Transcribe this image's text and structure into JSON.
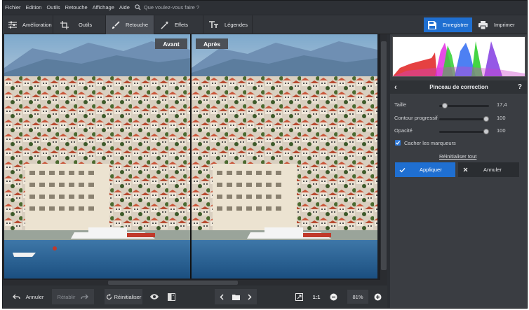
{
  "menu": [
    "Fichier",
    "Edition",
    "Outils",
    "Retouche",
    "Affichage",
    "Aide"
  ],
  "search": {
    "placeholder": "Que voulez-vous faire ?"
  },
  "toolbar": {
    "tabs": [
      {
        "label": "Amélioration",
        "icon": "sliders-icon"
      },
      {
        "label": "Outils",
        "icon": "crop-icon"
      },
      {
        "label": "Retouche",
        "icon": "brush-icon",
        "active": true
      },
      {
        "label": "Effets",
        "icon": "magic-wand-icon"
      },
      {
        "label": "Légendes",
        "icon": "text-icon"
      }
    ],
    "save_label": "Enregistrer",
    "print_label": "Imprimer"
  },
  "view": {
    "before_label": "Avant",
    "after_label": "Après"
  },
  "panel": {
    "title": "Pinceau de correction",
    "help": "?",
    "size": {
      "label": "Taille",
      "value": "17,4",
      "fraction": 0.07
    },
    "feather": {
      "label": "Contour progressif",
      "value": "100",
      "fraction": 1.0
    },
    "opacity": {
      "label": "Opacité",
      "value": "100",
      "fraction": 1.0
    },
    "hide_markers": {
      "label": "Cacher les marqueurs",
      "checked": true
    },
    "reset_all": "Réinitialiser tout",
    "apply_label": "Appliquer",
    "cancel_label": "Annuler"
  },
  "bottom": {
    "undo": "Annuler",
    "redo": "Rétablir",
    "reset": "Réinitialiser",
    "zoom_ratio": "1:1",
    "zoom_value": "81%"
  },
  "colors": {
    "accent": "#1f6fd1",
    "background": "#2b2e33",
    "panel": "#3a3d42"
  }
}
